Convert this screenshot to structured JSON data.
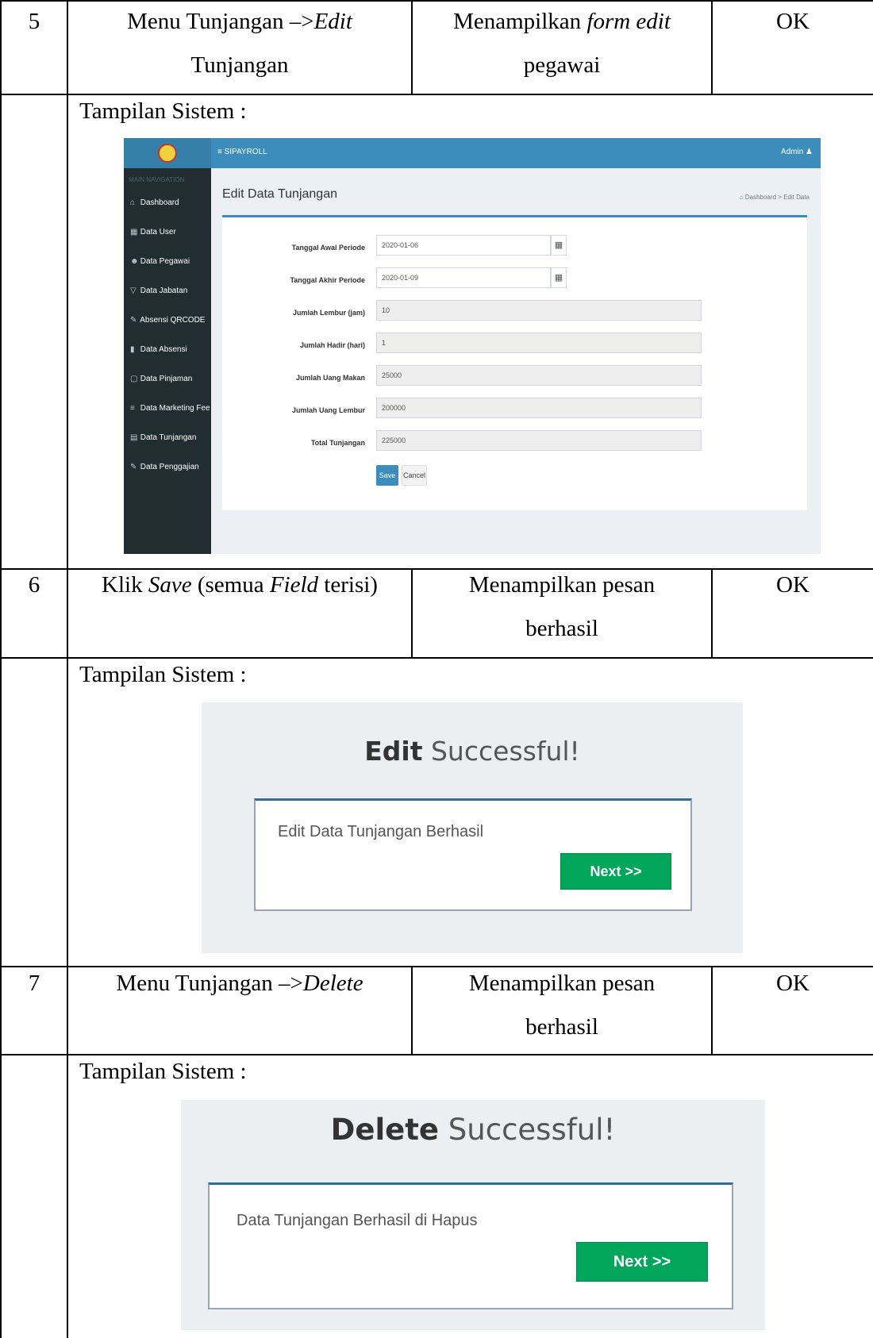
{
  "rows": [
    {
      "no": "5",
      "step_plain_1": "Menu Tunjangan –>",
      "step_italic_1": "Edit",
      "step_line2": "Tunjangan",
      "result_plain": "Menampilkan ",
      "result_italic": "form edit",
      "result_line2": "pegawai",
      "status": "OK"
    },
    {
      "no": "6",
      "step_a": "Klik ",
      "step_b": "Save",
      "step_c": " (semua ",
      "step_d": "Field",
      "step_e": " terisi)",
      "result_line1": "Menampilkan pesan",
      "result_line2": "berhasil",
      "status": "OK"
    },
    {
      "no": "7",
      "step_plain": "Menu Tunjangan –>",
      "step_italic": "Delete",
      "result_line1": "Menampilkan pesan",
      "result_line2": "berhasil",
      "status": "OK"
    }
  ],
  "tampilan_label": "Tampilan Sistem :",
  "screen_edit": {
    "brand": "≡ SIPAYROLL",
    "admin": "Admin ♟",
    "nav_header": "MAIN NAVIGATION",
    "nav": [
      {
        "icon": "⌂",
        "label": "Dashboard"
      },
      {
        "icon": "▦",
        "label": "Data User"
      },
      {
        "icon": "☻",
        "label": "Data Pegawai"
      },
      {
        "icon": "▽",
        "label": "Data Jabatan"
      },
      {
        "icon": "✎",
        "label": "Absensi QRCODE"
      },
      {
        "icon": "▮",
        "label": "Data Absensi"
      },
      {
        "icon": "▢",
        "label": "Data Pinjaman"
      },
      {
        "icon": "≡",
        "label": "Data Marketing Fee"
      },
      {
        "icon": "▤",
        "label": "Data Tunjangan"
      },
      {
        "icon": "✎",
        "label": "Data Penggajian"
      }
    ],
    "page_title": "Edit Data Tunjangan",
    "breadcrumb": "⌂ Dashboard > Edit Data",
    "fields": [
      {
        "label": "Tanggal Awal Periode",
        "value": "2020-01-06"
      },
      {
        "label": "Tanggal Akhir Periode",
        "value": "2020-01-09"
      },
      {
        "label": "Jumlah Lembur (jam)",
        "value": "10"
      },
      {
        "label": "Jumlah Hadir (hari)",
        "value": "1"
      },
      {
        "label": "Jumlah Uang Makan",
        "value": "25000"
      },
      {
        "label": "Jumlah Uang Lembur",
        "value": "200000"
      },
      {
        "label": "Total Tunjangan",
        "value": "225000"
      }
    ],
    "save": "Save",
    "cancel": "Cancel"
  },
  "screen_edit_success": {
    "title_bold": "Edit",
    "title_light": " Successful!",
    "message": "Edit Data Tunjangan Berhasil",
    "next": "Next >>"
  },
  "screen_delete_success": {
    "title_bold": "Delete",
    "title_light": " Successful!",
    "message": "Data Tunjangan Berhasil di Hapus",
    "next": "Next >>"
  }
}
